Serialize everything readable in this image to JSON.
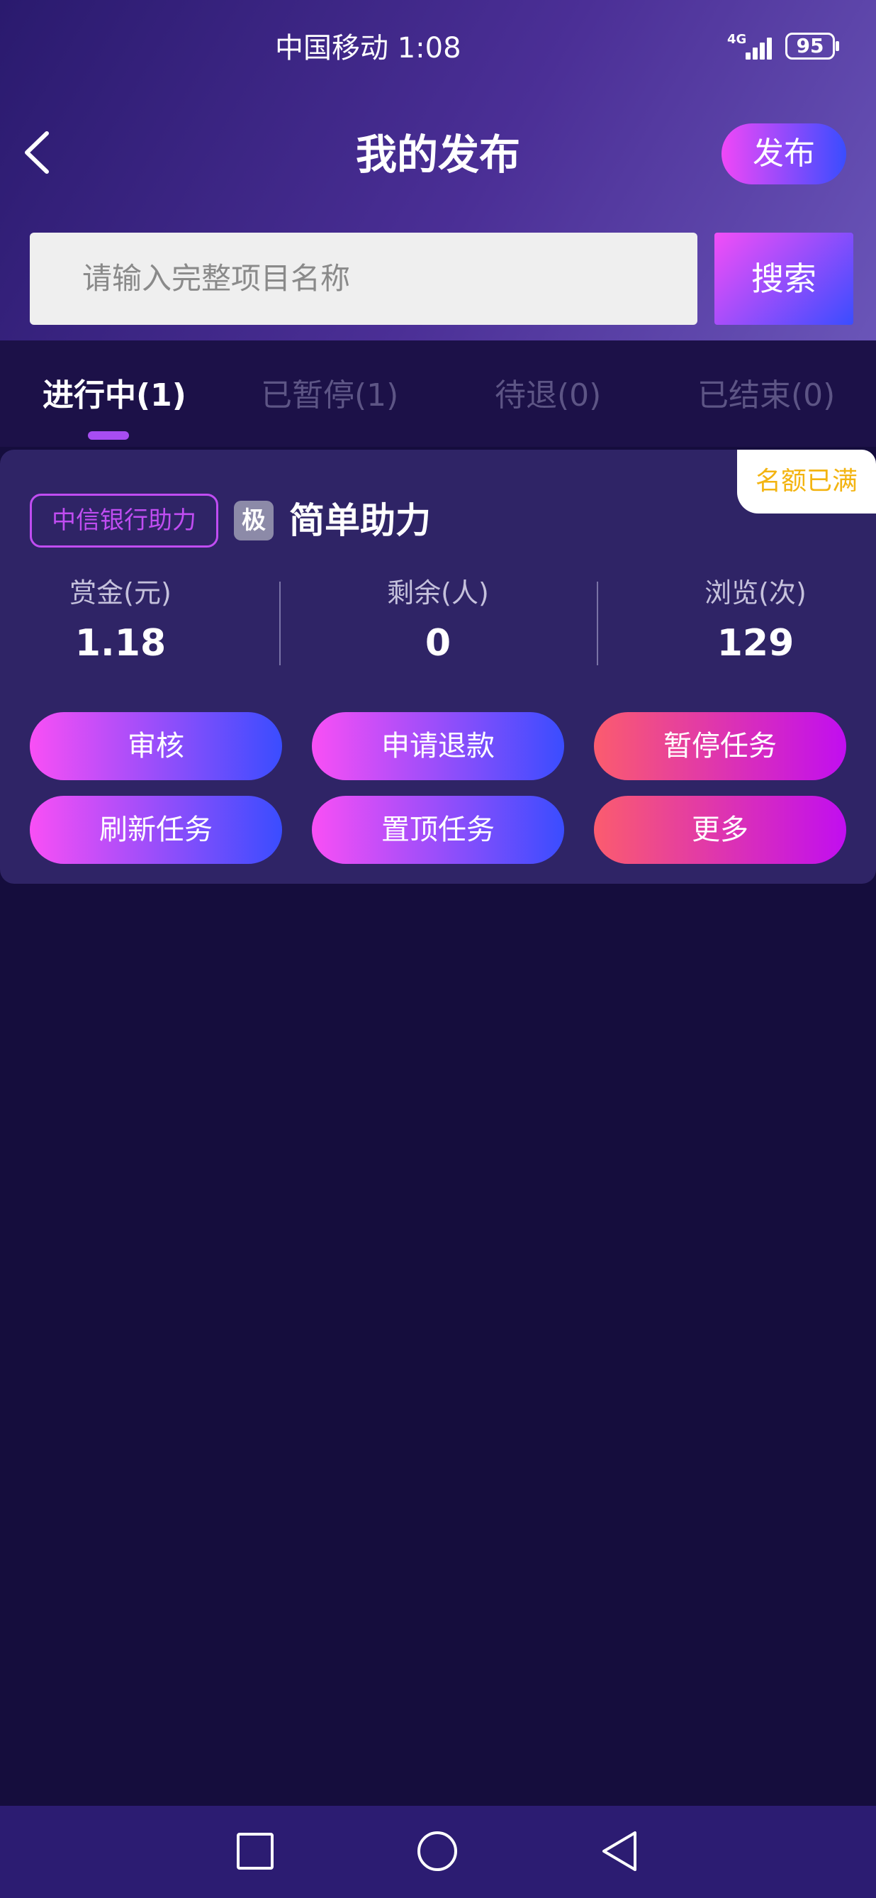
{
  "status_bar": {
    "carrier_time": "中国移动 1:08",
    "network": "4G",
    "battery": "95"
  },
  "header": {
    "title": "我的发布",
    "publish_label": "发布"
  },
  "search": {
    "placeholder": "请输入完整项目名称",
    "button_label": "搜索"
  },
  "tabs": [
    {
      "label": "进行中(1)",
      "active": true
    },
    {
      "label": "已暂停(1)",
      "active": false
    },
    {
      "label": "待退(0)",
      "active": false
    },
    {
      "label": "已结束(0)",
      "active": false
    }
  ],
  "task": {
    "quota_badge": "名额已满",
    "bank_tag": "中信银行助力",
    "level_badge": "极",
    "name": "简单助力",
    "stats": [
      {
        "label": "赏金(元)",
        "value": "1.18"
      },
      {
        "label": "剩余(人)",
        "value": "0"
      },
      {
        "label": "浏览(次)",
        "value": "129"
      }
    ],
    "actions": [
      "审核",
      "申请退款",
      "暂停任务",
      "刷新任务",
      "置顶任务",
      "更多"
    ]
  },
  "colors": {
    "accent_pink": "#f94ff5",
    "accent_blue": "#3a4dff",
    "accent_red": "#fb5c6e",
    "quota_yellow": "#f3b411",
    "background": "#150d3d"
  },
  "icons": [
    "back-arrow-icon",
    "signal-icon",
    "battery-icon",
    "square-nav-icon",
    "circle-nav-icon",
    "triangle-back-nav-icon"
  ]
}
